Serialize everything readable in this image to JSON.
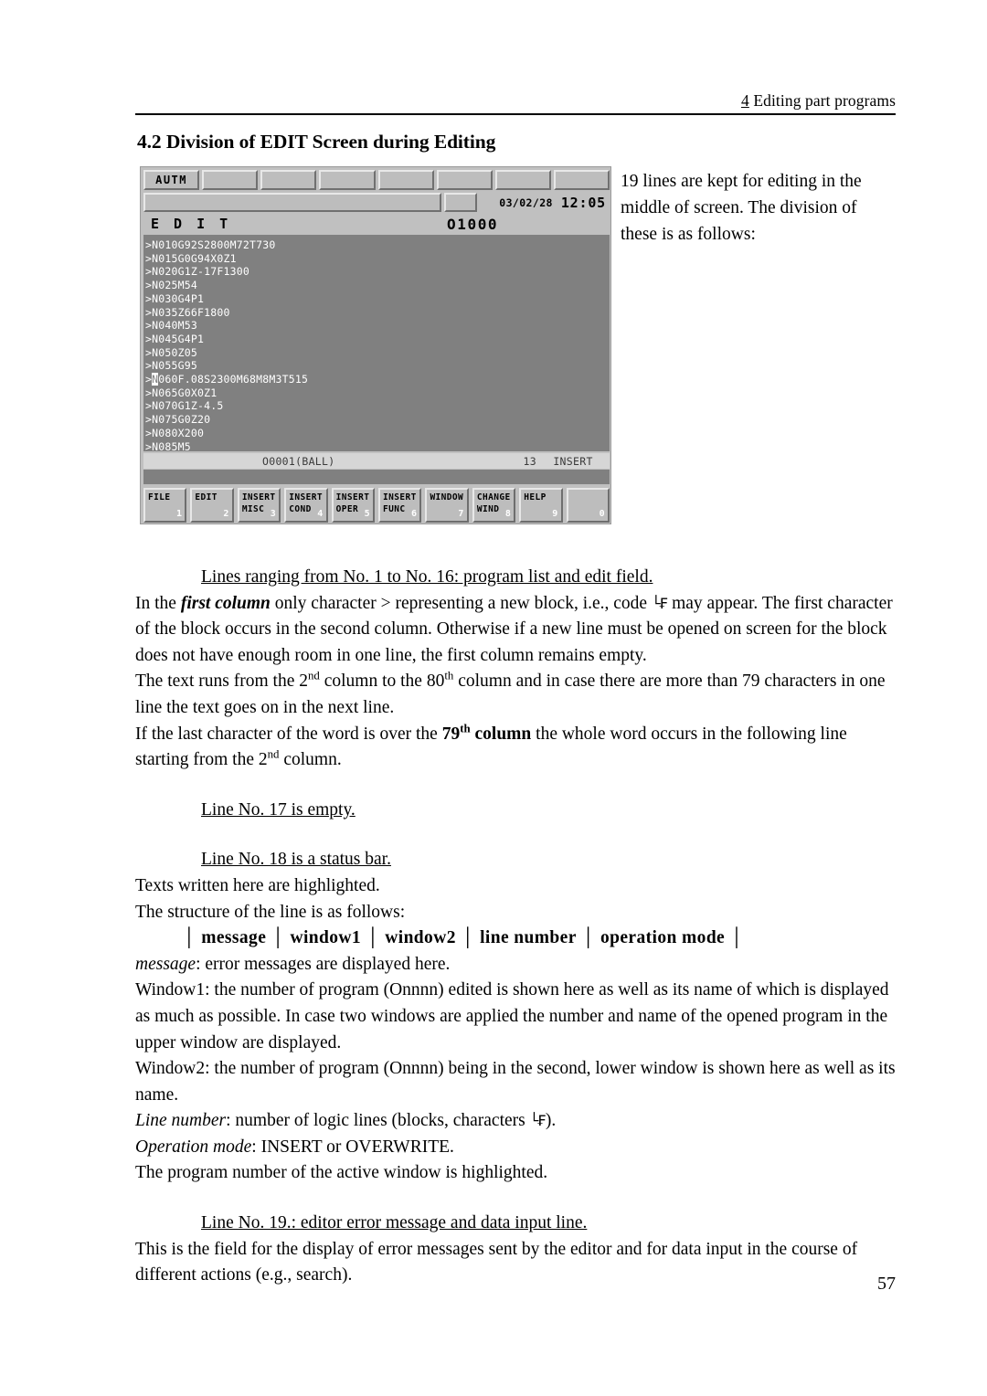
{
  "running_head": {
    "chapter_number": "4",
    "text": " Editing part programs"
  },
  "section": {
    "heading": "4.2 Division of EDIT Screen during Editing"
  },
  "side_paragraph": "19 lines are kept for editing in the middle of screen. The division of these is as follows:",
  "cnc_screen": {
    "tabs": [
      "AUTM",
      "",
      "",
      "",
      "",
      "",
      "",
      ""
    ],
    "date": "03/02/28",
    "time": "12:05",
    "mode": "E D I T",
    "program_number": "O1000",
    "program_lines": [
      ">N010G92S2800M72T730",
      ">N015G0G94X0Z1",
      ">N020G1Z-17F1300",
      ">N025M54",
      ">N030G4P1",
      ">N035Z66F1800",
      ">N040M53",
      ">N045G4P1",
      ">N050Z05",
      ">N055G95",
      ">N060F.08S2300M68M8M3T515",
      ">N065G0X0Z1",
      ">N070G1Z-4.5",
      ">N075G0Z20",
      ">N080X200",
      ">N085M5"
    ],
    "cursor_line_index": 10,
    "status_bar": {
      "message": "",
      "window1": "O0001(BALL)",
      "window2": "",
      "line_number": "13",
      "operation_mode": "INSERT"
    },
    "soft_keys": [
      {
        "line1": "FILE",
        "line2": "",
        "num": "1"
      },
      {
        "line1": "EDIT",
        "line2": "",
        "num": "2"
      },
      {
        "line1": "INSERT",
        "line2": "MISC",
        "num": "3"
      },
      {
        "line1": "INSERT",
        "line2": "COND",
        "num": "4"
      },
      {
        "line1": "INSERT",
        "line2": "OPER",
        "num": "5"
      },
      {
        "line1": "INSERT",
        "line2": "FUNC",
        "num": "6"
      },
      {
        "line1": "WINDOW",
        "line2": "",
        "num": "7"
      },
      {
        "line1": "CHANGE",
        "line2": "WIND",
        "num": "8"
      },
      {
        "line1": "HELP",
        "line2": "",
        "num": "9"
      },
      {
        "line1": "",
        "line2": "",
        "num": "0"
      }
    ]
  },
  "body": {
    "h1": "Lines ranging from No. 1 to No. 16: program list and edit field.",
    "p1_a": "In the ",
    "p1_b": "first column",
    "p1_c": " only character > representing a new block, i.e., code ",
    "p1_crlf": "└₣",
    "p1_d": " may appear. The first character of the block occurs in the second column. Otherwise if a new line must be opened on screen for the block does not have enough room in one line, the first column remains empty.",
    "p2_a": "The text runs from the 2",
    "p2_sup1": "nd",
    "p2_b": " column to the 80",
    "p2_sup2": "th",
    "p2_c": " column and in case there are more than 79 characters in one line the text goes on in the next line.",
    "p3_a": "If the last character of the word is over the ",
    "p3_b": "79",
    "p3_sup": "th",
    "p3_c": " column",
    "p3_d": " the whole word occurs in the following line starting from the 2",
    "p3_sup2": "nd",
    "p3_e": " column.",
    "h2": "Line No. 17 is empty.",
    "h3": "Line No. 18 is a status bar.",
    "p4": "Texts written here are highlighted.",
    "p5": "The structure of the line is as follows:",
    "struct": [
      "message",
      "window1",
      "window2",
      "line number",
      "operation mode"
    ],
    "struct_separator": "│",
    "p6_label": "message",
    "p6_text": ": error messages are displayed here.",
    "p7": "Window1: the number of program (Onnnn) edited is shown here as well as its name of which is displayed as much as possible. In case two windows are applied the number and name of the opened program in the upper window are displayed.",
    "p8": "Window2: the number of program (Onnnn) being in the second, lower window is shown here as well as its name.",
    "p9_label": "Line number",
    "p9_a": ": number of logic lines (blocks, characters ",
    "p9_crlf": "└₣",
    "p9_b": ").",
    "p10_label": "Operation mode",
    "p10_text": ": INSERT or OVERWRITE.",
    "p11": "The program number of the active window is highlighted.",
    "h4": "Line No. 19.: editor error message and data input line.",
    "p12": "This is the field for the display of error messages sent by the editor and for data input in the course of different actions (e.g., search)."
  },
  "page_number": "57"
}
